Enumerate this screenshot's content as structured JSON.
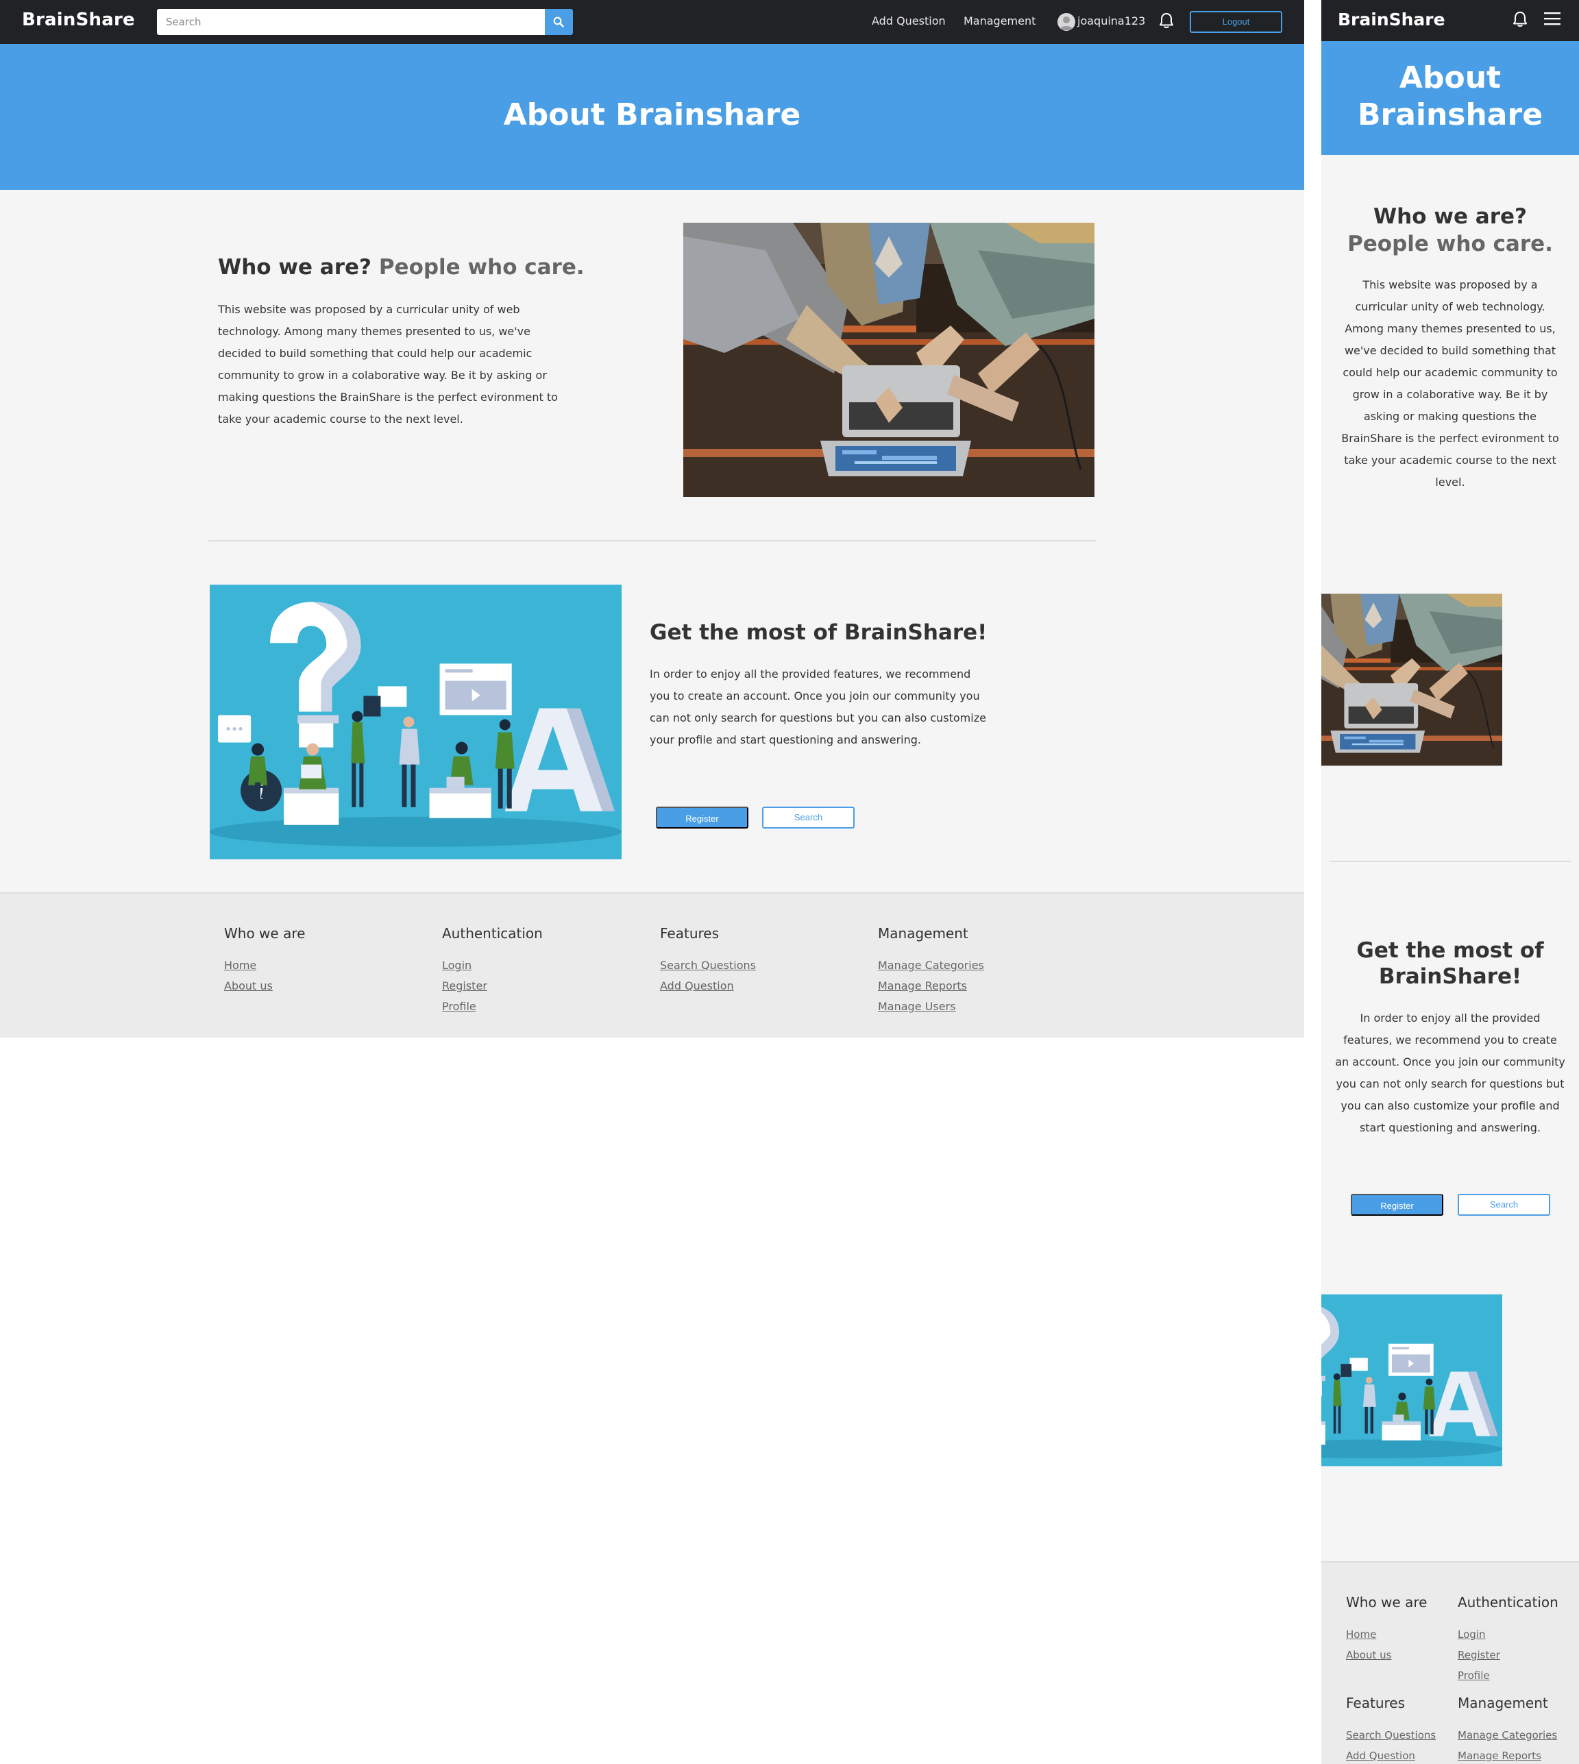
{
  "nav": {
    "brand": "BrainShare",
    "search_placeholder": "Search",
    "add_question": "Add Question",
    "management": "Management",
    "username": "joaquina123",
    "logout": "Logout"
  },
  "hero": {
    "title": "About Brainshare"
  },
  "who": {
    "title": "Who we are?",
    "accent": "People who care.",
    "text": "This website was proposed by a curricular unity of web technology. Among many themes presented to us, we've decided to build something that could help our academic community to grow in a colaborative way. Be it by asking or making questions the BrainShare is the perfect evironment to take your academic course to the next level."
  },
  "most": {
    "title": "Get the most of BrainShare!",
    "text": "In order to enjoy all the provided features, we recommend you to create an account. Once you join our community you can not only search for questions but you can also customize your profile and start questioning and answering.",
    "register": "Register",
    "search": "Search"
  },
  "footer": {
    "columns": [
      {
        "title": "Who we are",
        "links": [
          "Home",
          "About us"
        ]
      },
      {
        "title": "Authentication",
        "links": [
          "Login",
          "Register",
          "Profile"
        ]
      },
      {
        "title": "Features",
        "links": [
          "Search Questions",
          "Add Question"
        ]
      },
      {
        "title": "Management",
        "links": [
          "Manage Categories",
          "Manage Reports",
          "Manage Users"
        ]
      }
    ]
  },
  "colors": {
    "navbar": "#202225",
    "primary": "#4a9ee6",
    "page_bg": "#f5f5f5",
    "footer_bg": "#ebebeb"
  },
  "icons": [
    "search-icon",
    "bell-icon",
    "avatar-icon",
    "hamburger-menu-icon"
  ]
}
